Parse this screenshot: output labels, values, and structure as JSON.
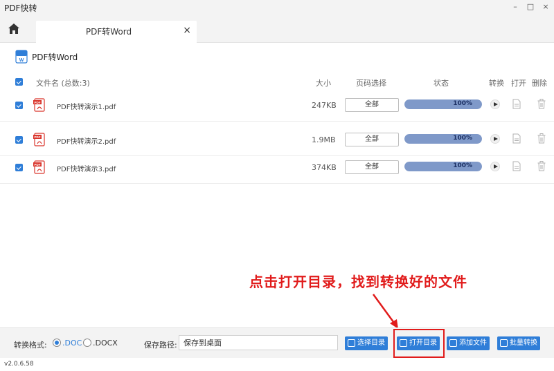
{
  "window": {
    "title": "PDF快转",
    "controls": [
      "–",
      "□",
      "×"
    ]
  },
  "tab": {
    "label": "PDF转Word",
    "close": "×"
  },
  "heading": {
    "label": "PDF转Word"
  },
  "table": {
    "headers": {
      "filename": "文件名 (总数:3)",
      "size": "大小",
      "pages": "页码选择",
      "status": "状态",
      "convert": "转换",
      "open": "打开",
      "delete": "删除"
    },
    "rows": [
      {
        "name": "PDF快转演示1.pdf",
        "size": "247KB",
        "pages": "全部",
        "progress": 100,
        "progress_label": "100%"
      },
      {
        "name": "PDF快转演示2.pdf",
        "size": "1.9MB",
        "pages": "全部",
        "progress": 100,
        "progress_label": "100%"
      },
      {
        "name": "PDF快转演示3.pdf",
        "size": "374KB",
        "pages": "全部",
        "progress": 100,
        "progress_label": "100%"
      }
    ]
  },
  "annotation": {
    "text": "点击打开目录，找到转换好的文件"
  },
  "bottom": {
    "format_label": "转换格式:",
    "format_doc": ".DOC",
    "format_docx": ".DOCX",
    "path_label": "保存路径:",
    "path_value": "保存到桌面",
    "btn_choose_dir": "选择目录",
    "btn_open_dir": "打开目录",
    "btn_add_file": "添加文件",
    "btn_batch_convert": "批量转换"
  },
  "version": "v2.0.6.58",
  "colors": {
    "accent": "#2f7ed8",
    "progress": "#7f99c9",
    "annotation": "#e11b1b",
    "pdf": "#d9342b"
  },
  "icons": [
    "home-icon",
    "chat-icon",
    "headset-icon",
    "user-icon",
    "gear-icon",
    "word-file-icon",
    "pdf-file-icon",
    "play-icon",
    "open-file-icon",
    "trash-icon"
  ]
}
